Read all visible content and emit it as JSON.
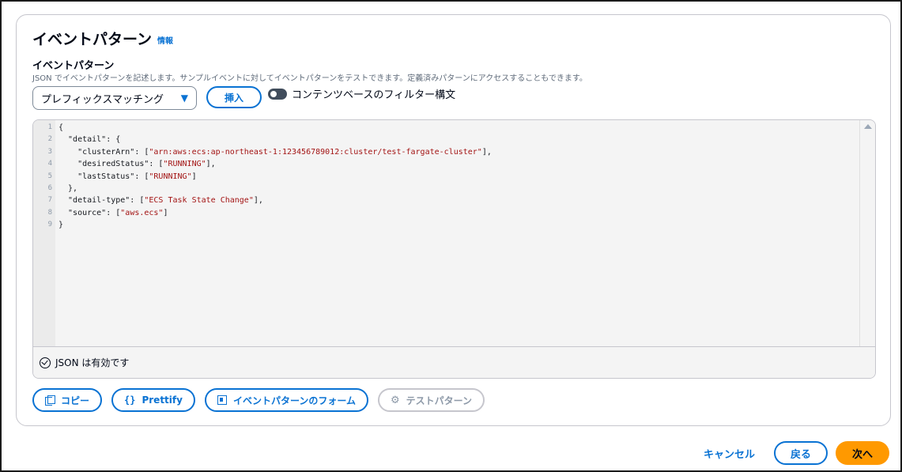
{
  "section": {
    "title": "イベントパターン",
    "info_link": "情報"
  },
  "field": {
    "label": "イベントパターン",
    "description": "JSON でイベントパターンを記述します。サンプルイベントに対してイベントパターンをテストできます。定義済みパターンにアクセスすることもできます。"
  },
  "controls": {
    "select_value": "プレフィックスマッチング",
    "insert_label": "挿入",
    "toggle_label": "コンテンツベースのフィルター構文"
  },
  "editor": {
    "lines": [
      {
        "no": "1",
        "parts": [
          {
            "t": "{"
          }
        ]
      },
      {
        "no": "2",
        "parts": [
          {
            "t": "  \"detail\": {"
          }
        ]
      },
      {
        "no": "3",
        "parts": [
          {
            "t": "    \"clusterArn\": ["
          },
          {
            "s": "\"arn:aws:ecs:ap-northeast-1:123456789012:cluster/test-fargate-cluster\""
          },
          {
            "t": "],"
          }
        ]
      },
      {
        "no": "4",
        "parts": [
          {
            "t": "    \"desiredStatus\": ["
          },
          {
            "s": "\"RUNNING\""
          },
          {
            "t": "],"
          }
        ]
      },
      {
        "no": "5",
        "parts": [
          {
            "t": "    \"lastStatus\": ["
          },
          {
            "s": "\"RUNNING\""
          },
          {
            "t": "]"
          }
        ]
      },
      {
        "no": "6",
        "parts": [
          {
            "t": "  },"
          }
        ]
      },
      {
        "no": "7",
        "parts": [
          {
            "t": "  \"detail-type\": ["
          },
          {
            "s": "\"ECS Task State Change\""
          },
          {
            "t": "],"
          }
        ]
      },
      {
        "no": "8",
        "parts": [
          {
            "t": "  \"source\": ["
          },
          {
            "s": "\"aws.ecs\""
          },
          {
            "t": "]"
          }
        ]
      },
      {
        "no": "9",
        "parts": [
          {
            "t": "}"
          }
        ]
      }
    ],
    "status": "JSON は有効です"
  },
  "actions": {
    "copy": "コピー",
    "prettify": "Prettify",
    "form": "イベントパターンのフォーム",
    "test": "テストパターン"
  },
  "footer": {
    "cancel": "キャンセル",
    "back": "戻る",
    "next": "次へ"
  },
  "colors": {
    "accent": "#0972d3",
    "primary_button": "#ff9900",
    "string": "#a31515"
  }
}
